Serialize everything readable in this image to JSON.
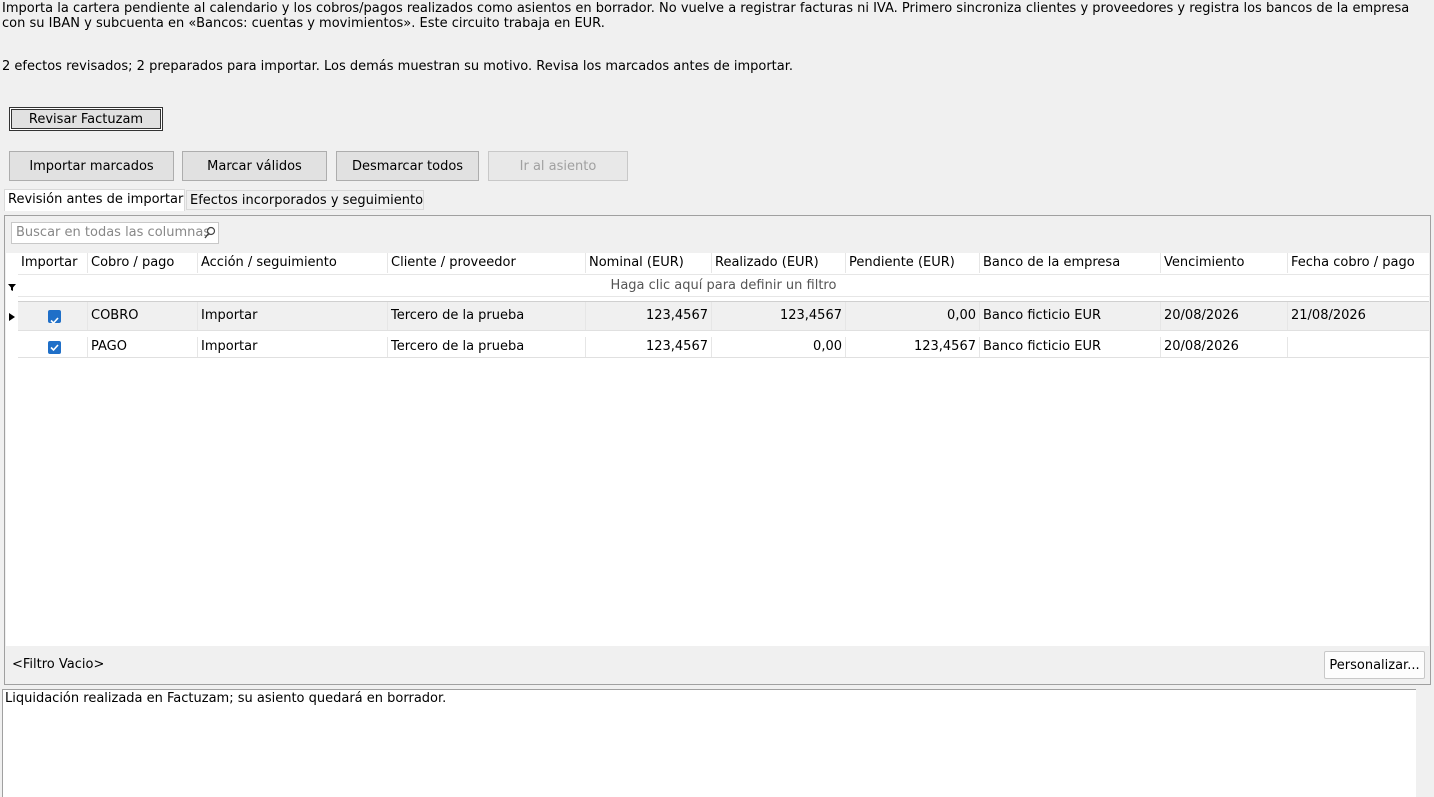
{
  "intro_text": "Importa la cartera pendiente al calendario y los cobros/pagos realizados como asientos en borrador. No vuelve a registrar facturas ni IVA. Primero sincroniza clientes y proveedores y registra los bancos de la empresa con su IBAN y subcuenta en «Bancos: cuentas y movimientos». Este circuito trabaja en EUR.",
  "summary_text": "2 efectos revisados; 2 preparados para importar. Los demás muestran su motivo. Revisa los marcados antes de importar.",
  "buttons": {
    "review": "Revisar Factuzam",
    "import_marked": "Importar marcados",
    "mark_valid": "Marcar válidos",
    "unmark_all": "Desmarcar todos",
    "goto_entry": "Ir al asiento"
  },
  "tabs": [
    {
      "label": "Revisión antes de importar"
    },
    {
      "label": "Efectos incorporados y seguimiento"
    }
  ],
  "search": {
    "placeholder": "Buscar en todas las columnas"
  },
  "columns": [
    {
      "label": "Importar"
    },
    {
      "label": "Cobro / pago"
    },
    {
      "label": "Acción / seguimiento"
    },
    {
      "label": "Cliente / proveedor"
    },
    {
      "label": "Nominal (EUR)"
    },
    {
      "label": "Realizado (EUR)"
    },
    {
      "label": "Pendiente (EUR)"
    },
    {
      "label": "Banco de la empresa"
    },
    {
      "label": "Vencimiento"
    },
    {
      "label": "Fecha cobro / pago"
    }
  ],
  "filter_row_text": "Haga clic aquí para definir un filtro",
  "rows": [
    {
      "importar": true,
      "tipo": "COBRO",
      "accion": "Importar",
      "tercero": "Tercero de la prueba",
      "nominal": "123,4567",
      "realizado": "123,4567",
      "pendiente": "0,00",
      "banco": "Banco ficticio EUR",
      "vencimiento": "20/08/2026",
      "fecha": "21/08/2026"
    },
    {
      "importar": true,
      "tipo": "PAGO",
      "accion": "Importar",
      "tercero": "Tercero de la prueba",
      "nominal": "123,4567",
      "realizado": "0,00",
      "pendiente": "123,4567",
      "banco": "Banco ficticio EUR",
      "vencimiento": "20/08/2026",
      "fecha": ""
    }
  ],
  "footer": {
    "filter_status": "<Filtro Vacio>",
    "customize_label": "Personalizar..."
  },
  "detail_text": "Liquidación realizada en Factuzam; su asiento quedará en borrador.",
  "colors": {
    "checkbox": "#1f6fc8",
    "background": "#f0f0f0"
  }
}
